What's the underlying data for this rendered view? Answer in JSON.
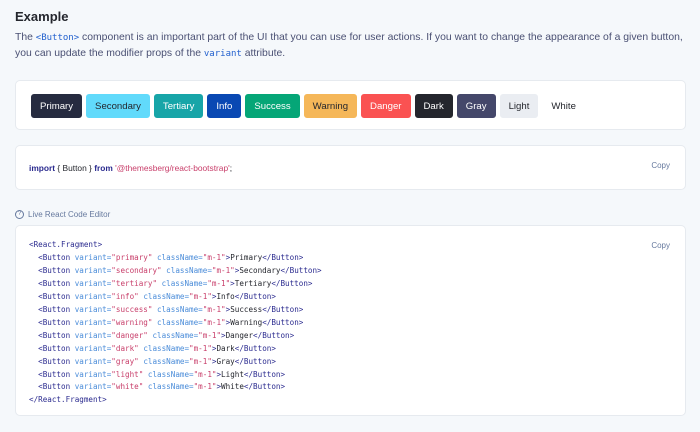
{
  "heading": "Example",
  "description": {
    "part1": "The ",
    "code1": "<Button>",
    "part2": " component is an important part of the UI that you can use for user actions. If you want to change the appearance of a given button, you can update the modifier props of the ",
    "code2": "variant",
    "part3": " attribute."
  },
  "buttons": [
    {
      "label": "Primary",
      "bg": "#262b40",
      "fg": "#ffffff",
      "border": "#262b40"
    },
    {
      "label": "Secondary",
      "bg": "#61dafb",
      "fg": "#24262d",
      "border": "#61dafb"
    },
    {
      "label": "Tertiary",
      "bg": "#17a5a8",
      "fg": "#ffffff",
      "border": "#17a5a8"
    },
    {
      "label": "Info",
      "bg": "#0948b3",
      "fg": "#ffffff",
      "border": "#0948b3"
    },
    {
      "label": "Success",
      "bg": "#05a677",
      "fg": "#ffffff",
      "border": "#05a677"
    },
    {
      "label": "Warning",
      "bg": "#f5b759",
      "fg": "#24262d",
      "border": "#f5b759"
    },
    {
      "label": "Danger",
      "bg": "#fa5252",
      "fg": "#ffffff",
      "border": "#fa5252"
    },
    {
      "label": "Dark",
      "bg": "#24262d",
      "fg": "#ffffff",
      "border": "#24262d"
    },
    {
      "label": "Gray",
      "bg": "#44476a",
      "fg": "#ffffff",
      "border": "#44476a"
    },
    {
      "label": "Light",
      "bg": "#eaedf2",
      "fg": "#24262d",
      "border": "#eaedf2"
    },
    {
      "label": "White",
      "bg": "#ffffff",
      "fg": "#24262d",
      "border": "#ffffff"
    }
  ],
  "import_snippet": {
    "kw1": "import",
    "mid": " { Button } ",
    "kw2": "from",
    "str": "'@themesberg/react-bootstrap'",
    "end": ";"
  },
  "copy_label": "Copy",
  "editor_label": "Live React Code Editor",
  "code": {
    "open": "<React.Fragment>",
    "close": "</React.Fragment>",
    "attr_variant": "variant=",
    "attr_class": "className=",
    "class_value": "\"m-1\"",
    "lines": [
      {
        "variant": "\"primary\"",
        "text": "Primary"
      },
      {
        "variant": "\"secondary\"",
        "text": "Secondary"
      },
      {
        "variant": "\"tertiary\"",
        "text": "Tertiary"
      },
      {
        "variant": "\"info\"",
        "text": "Info"
      },
      {
        "variant": "\"success\"",
        "text": "Success"
      },
      {
        "variant": "\"warning\"",
        "text": "Warning"
      },
      {
        "variant": "\"danger\"",
        "text": "Danger"
      },
      {
        "variant": "\"dark\"",
        "text": "Dark"
      },
      {
        "variant": "\"gray\"",
        "text": "Gray"
      },
      {
        "variant": "\"light\"",
        "text": "Light"
      },
      {
        "variant": "\"white\"",
        "text": "White"
      }
    ]
  }
}
